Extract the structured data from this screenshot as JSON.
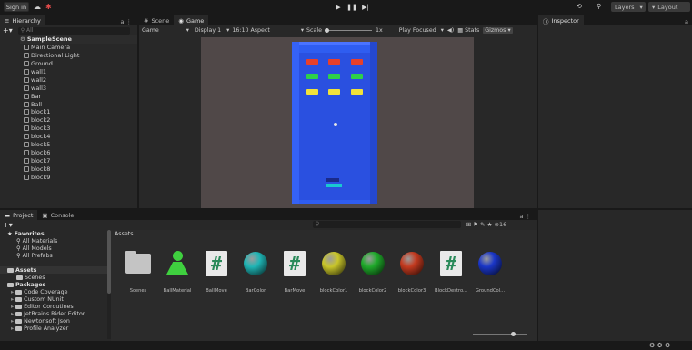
{
  "toolbar": {
    "sign_in": "Sign in",
    "layers": "Layers",
    "layout": "Layout"
  },
  "hierarchy": {
    "tab": "Hierarchy",
    "search_placeholder": "All",
    "scene": "SampleScene",
    "items": [
      "Main Camera",
      "Directional Light",
      "Ground",
      "wall1",
      "wall2",
      "wall3",
      "Bar",
      "Ball",
      "block1",
      "block2",
      "block3",
      "block4",
      "block5",
      "block6",
      "block7",
      "block8",
      "block9"
    ]
  },
  "scene_tabs": {
    "scene": "Scene",
    "game": "Game"
  },
  "game_bar": {
    "mode": "Game",
    "display": "Display 1",
    "aspect": "16:10 Aspect",
    "scale_label": "Scale",
    "scale_value": "1x",
    "play_focused": "Play Focused",
    "stats": "Stats",
    "gizmos": "Gizmos"
  },
  "inspector": {
    "tab": "Inspector"
  },
  "project": {
    "tab_project": "Project",
    "tab_console": "Console",
    "favorites": "Favorites",
    "favorite_items": [
      "All Materials",
      "All Models",
      "All Prefabs"
    ],
    "assets": "Assets",
    "asset_children": [
      "Scenes"
    ],
    "packages": "Packages",
    "package_items": [
      "Code Coverage",
      "Custom NUnit",
      "Editor Coroutines",
      "JetBrains Rider Editor",
      "Newtonsoft Json",
      "Profile Analyzer"
    ],
    "breadcrumb": "Assets",
    "hidden_count": "16",
    "asset_items": [
      {
        "label": "Scenes",
        "kind": "folder"
      },
      {
        "label": "BallMaterial",
        "kind": "material",
        "color": "#3fd03f"
      },
      {
        "label": "BallMove",
        "kind": "script"
      },
      {
        "label": "BarColor",
        "kind": "sphere",
        "color": "#1fb5b5"
      },
      {
        "label": "BarMove",
        "kind": "script"
      },
      {
        "label": "blockColor1",
        "kind": "sphere",
        "color": "#c9c62a"
      },
      {
        "label": "blockColor2",
        "kind": "sphere",
        "color": "#1faa2a"
      },
      {
        "label": "blockColor3",
        "kind": "sphere",
        "color": "#c43a1f"
      },
      {
        "label": "BlockDestro...",
        "kind": "script"
      },
      {
        "label": "GroundCol...",
        "kind": "sphere",
        "color": "#1a36c8"
      }
    ]
  },
  "colors": {
    "board": "#2f5df0",
    "brick_red": "#e8402a",
    "brick_green": "#2ed04a",
    "brick_yellow": "#f2e23a",
    "paddle": "#19c8d0",
    "game_bg": "#504848"
  }
}
